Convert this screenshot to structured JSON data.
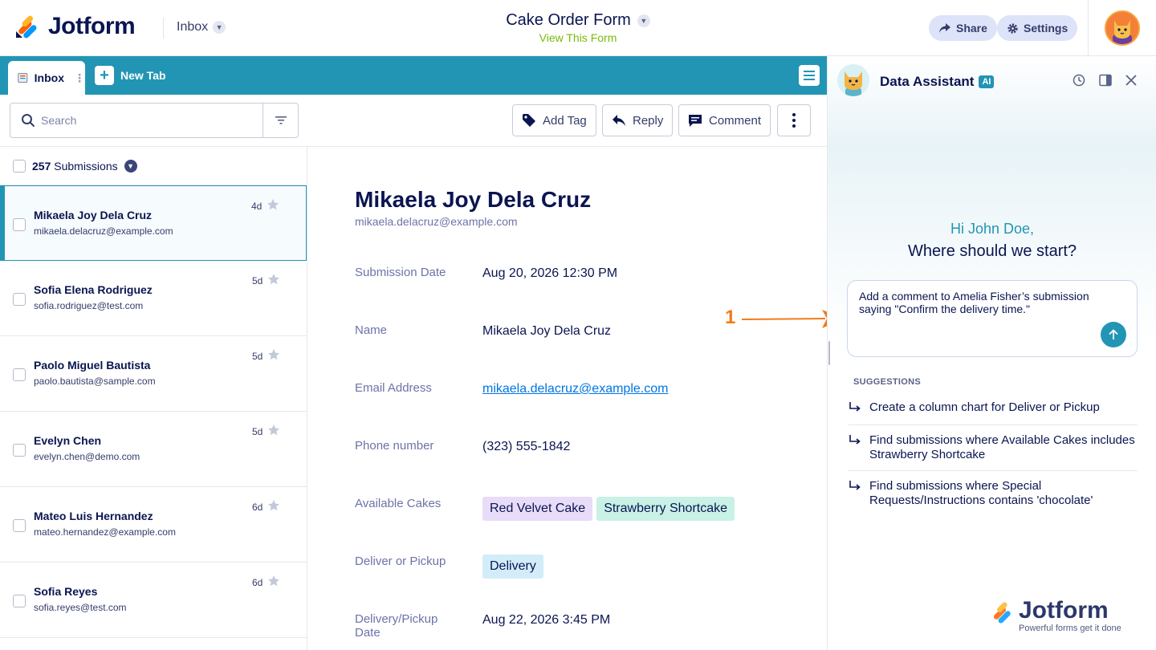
{
  "header": {
    "brand": "Jotform",
    "inbox_label": "Inbox",
    "form_title": "Cake Order Form",
    "view_form": "View This Form",
    "share_label": "Share",
    "settings_label": "Settings"
  },
  "tabs": {
    "inbox_label": "Inbox",
    "new_tab_label": "New Tab"
  },
  "toolbar": {
    "search_placeholder": "Search",
    "add_tag": "Add Tag",
    "reply": "Reply",
    "comment": "Comment"
  },
  "list": {
    "count": "257",
    "count_label": "Submissions",
    "items": [
      {
        "name": "Mikaela Joy Dela Cruz",
        "email": "mikaela.delacruz@example.com",
        "age": "4d"
      },
      {
        "name": "Sofia Elena Rodriguez",
        "email": "sofia.rodriguez@test.com",
        "age": "5d"
      },
      {
        "name": "Paolo Miguel Bautista",
        "email": "paolo.bautista@sample.com",
        "age": "5d"
      },
      {
        "name": "Evelyn Chen",
        "email": "evelyn.chen@demo.com",
        "age": "5d"
      },
      {
        "name": "Mateo Luis Hernandez",
        "email": "mateo.hernandez@example.com",
        "age": "6d"
      },
      {
        "name": "Sofia Reyes",
        "email": "sofia.reyes@test.com",
        "age": "6d"
      }
    ]
  },
  "detail": {
    "name": "Mikaela Joy Dela Cruz",
    "email": "mikaela.delacruz@example.com",
    "fields": [
      {
        "label": "Submission Date",
        "value": "Aug 20, 2026 12:30 PM"
      },
      {
        "label": "Name",
        "value": "Mikaela Joy Dela Cruz"
      },
      {
        "label": "Email Address",
        "value": "mikaela.delacruz@example.com"
      },
      {
        "label": "Phone number",
        "value": "(323) 555-1842"
      },
      {
        "label": "Available Cakes",
        "tags": [
          "Red Velvet Cake",
          "Strawberry Shortcake"
        ]
      },
      {
        "label": "Deliver or Pickup",
        "tags": [
          "Delivery"
        ]
      },
      {
        "label": "Delivery/Pickup Date",
        "value": "Aug 22, 2026 3:45 PM"
      }
    ]
  },
  "assistant": {
    "title": "Data Assistant",
    "badge": "AI",
    "greeting": "Hi John Doe,",
    "prompt": "Where should we start?",
    "input_value": "Add a comment to Amelia Fisher’s submission saying \"Confirm the delivery time.\"",
    "suggestions_heading": "SUGGESTIONS",
    "suggestions": [
      "Create a column chart for Deliver or Pickup",
      "Find submissions where Available Cakes includes Strawberry Shortcake",
      "Find submissions where Special Requests/Instructions contains 'chocolate'"
    ],
    "watermark_brand": "Jotform",
    "watermark_tagline": "Powerful forms get it done"
  },
  "annotation": {
    "step_number": "1"
  },
  "colors": {
    "accent": "#2295b4",
    "navy": "#0a1551",
    "link": "#0075e3",
    "tag_purple": "#e8dcf8",
    "tag_mint": "#c9f1e6",
    "tag_blue": "#d3ecf9",
    "annotation_orange": "#f07c1a"
  }
}
